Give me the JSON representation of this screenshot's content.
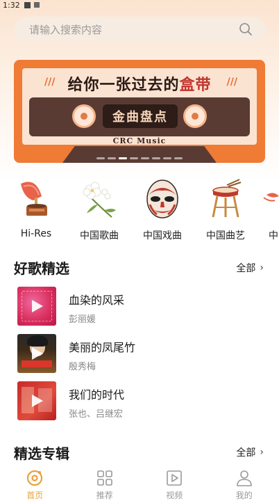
{
  "status_bar": {
    "time": "1:32"
  },
  "search": {
    "placeholder": "请输入搜索内容"
  },
  "banner": {
    "headline_prefix": "给你一张过去的",
    "headline_highlight": "盒带",
    "slashes_left": "///",
    "slashes_right": "///",
    "label": "金曲盘点",
    "brand": "CRC Music",
    "page_count": 8,
    "active_page": 3
  },
  "categories": [
    {
      "label": "Hi-Res",
      "icon": "gramophone-icon"
    },
    {
      "label": "中国歌曲",
      "icon": "jasmine-flower-icon"
    },
    {
      "label": "中国戏曲",
      "icon": "opera-mask-icon"
    },
    {
      "label": "中国曲艺",
      "icon": "drum-icon"
    },
    {
      "label": "中",
      "icon": "ribbon-icon"
    }
  ],
  "sections": {
    "featured_songs": {
      "title": "好歌精选",
      "more": "全部"
    },
    "featured_albums": {
      "title": "精选专辑",
      "more": "全部"
    }
  },
  "songs": [
    {
      "title": "血染的风采",
      "artist": "彭丽媛"
    },
    {
      "title": "美丽的凤尾竹",
      "artist": "殷秀梅"
    },
    {
      "title": "我们的时代",
      "artist": "张也、吕继宏"
    }
  ],
  "nav": [
    {
      "label": "首页",
      "icon": "home-disc-icon",
      "active": true
    },
    {
      "label": "推荐",
      "icon": "grid-icon",
      "active": false
    },
    {
      "label": "视频",
      "icon": "video-icon",
      "active": false
    },
    {
      "label": "我的",
      "icon": "user-icon",
      "active": false
    }
  ],
  "colors": {
    "accent": "#e8a13a",
    "banner_orange": "#ef7b35",
    "banner_dark": "#5a3b34",
    "search_bg": "#f7ece2"
  }
}
